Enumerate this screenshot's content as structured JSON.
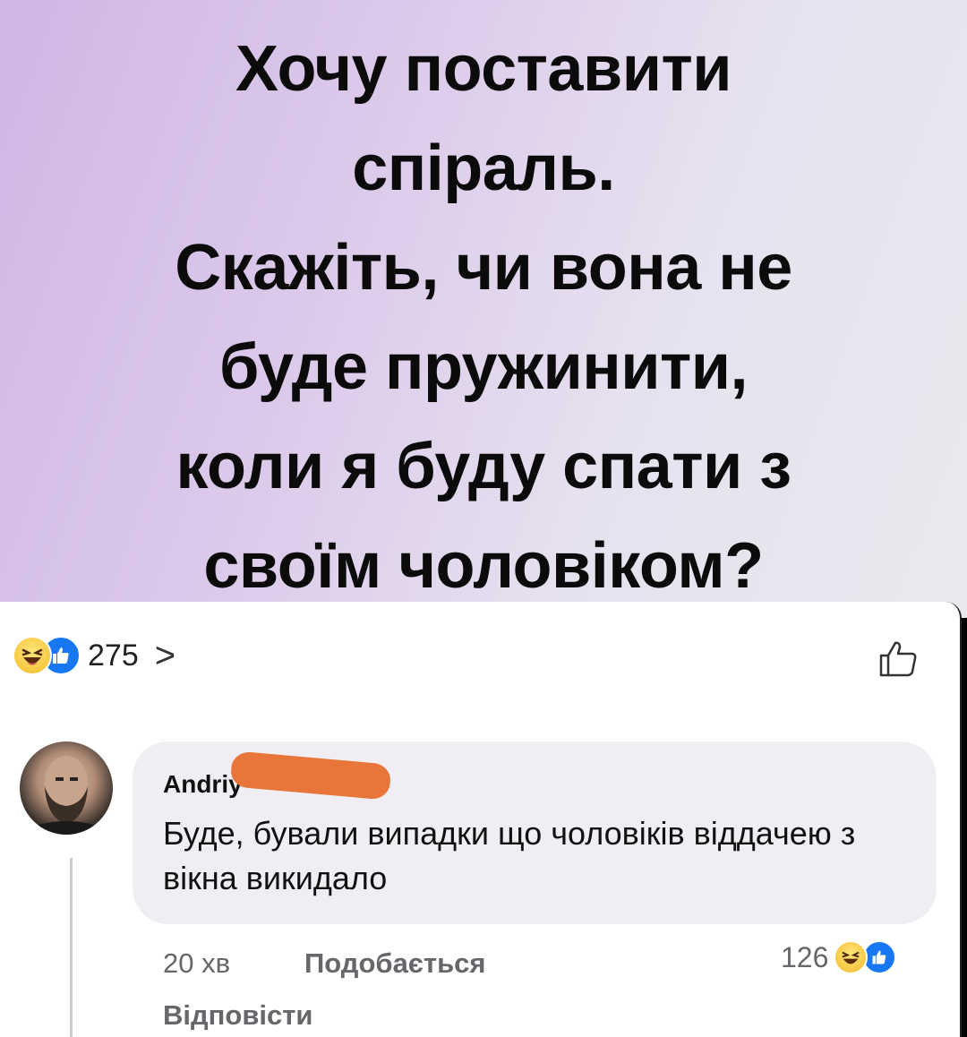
{
  "post": {
    "lines": [
      "Хочу поставити",
      "спіраль.",
      "Скажіть, чи вона не",
      "буде пружинити,",
      "коли я буду спати з",
      "своїм чоловіком?"
    ]
  },
  "reactions": {
    "count": "275",
    "chevron": ">",
    "icons": [
      "haha-emoji-icon",
      "like-reaction-icon"
    ]
  },
  "comment": {
    "author": "Andriy",
    "text": "Буде, бували випадки що чоловіків віддачею з вікна викидало",
    "time": "20 хв",
    "like_label": "Подобається",
    "reply_label": "Відповісти",
    "reaction_count": "126"
  },
  "colors": {
    "like_blue": "#1877f2",
    "haha_yellow": "#f7c842",
    "redaction": "#e8763a"
  }
}
